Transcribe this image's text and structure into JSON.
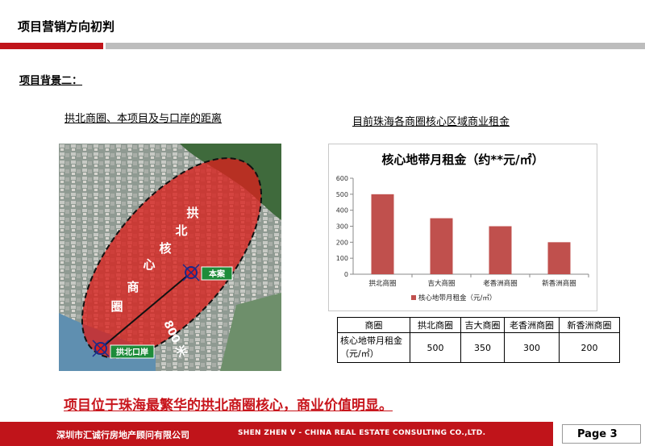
{
  "header": {
    "title": "项目营销方向初判",
    "subtitle": "项目背景二："
  },
  "map": {
    "caption": "拱北商圈、本项目及与口岸的距离",
    "zone_chars": [
      "拱",
      "北",
      "核",
      "心",
      "商",
      "圈"
    ],
    "distance_label": "800 米",
    "project_label": "本案",
    "port_label": "拱北口岸",
    "zone_color": "#d9201c"
  },
  "chart": {
    "caption": "目前珠海各商圈核心区域商业租金",
    "chart_data": {
      "type": "bar",
      "title": "核心地带月租金（约**元/㎡）",
      "categories": [
        "拱北商圈",
        "吉大商圈",
        "老香洲商圈",
        "新香洲商圈"
      ],
      "series": [
        {
          "name": "核心地带月租金（元/㎡）",
          "values": [
            500,
            350,
            300,
            200
          ]
        }
      ],
      "ylim": [
        0,
        600
      ],
      "yticks": [
        "600",
        "500",
        "400",
        "300",
        "200",
        "100",
        "0"
      ],
      "legend_position": "bottom",
      "bar_color": "#c0504d",
      "grid": false
    }
  },
  "table": {
    "header": [
      "商圈",
      "拱北商圈",
      "吉大商圈",
      "老香洲商圈",
      "新香洲商圈"
    ],
    "row_label": "核心地带月租金（元/㎡）",
    "values": [
      "500",
      "350",
      "300",
      "200"
    ]
  },
  "conclusion": "项目位于珠海最繁华的拱北商圈核心，商业价值明显。",
  "footer": {
    "company": "深圳市汇诚行房地产顾问有限公司",
    "english": "SHEN ZHEN V - CHINA REAL ESTATE CONSULTING  CO.,LTD.",
    "page_label": "Page 3"
  },
  "colors": {
    "accent": "#c0141a",
    "divider_gray": "#bdbdbd"
  }
}
